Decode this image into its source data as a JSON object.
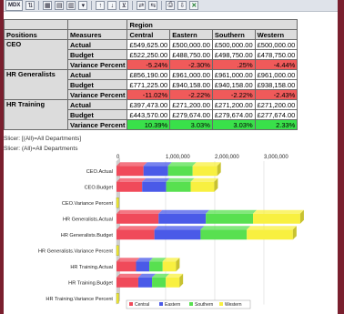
{
  "toolbar": {
    "mdx_label": "MDX",
    "icons": [
      "sort-icon",
      "table-view-icon",
      "chart-view-icon",
      "both-view-icon",
      "chart-type-icon",
      "drill-up-icon",
      "drill-down-icon",
      "filter-icon",
      "swap-axis-icon",
      "print-icon",
      "export-icon",
      "excel-icon"
    ]
  },
  "table": {
    "region_label": "Region",
    "col_positions": "Positions",
    "col_measures": "Measures",
    "regions": [
      "Central",
      "Eastern",
      "Southern",
      "Western"
    ],
    "groups": [
      {
        "position": "CEO",
        "rows": [
          {
            "measure": "Actual",
            "values": [
              "£549,625.00",
              "£500,000.00",
              "£500,000.00",
              "£500,000.00"
            ],
            "style": "num"
          },
          {
            "measure": "Budget",
            "values": [
              "£522,250.00",
              "£488,750.00",
              "£498,750.00",
              "£478,750.00"
            ],
            "style": "num"
          },
          {
            "measure": "Variance Percent",
            "values": [
              "-5.24%",
              "-2.30%",
              ".25%",
              "-4.44%"
            ],
            "style": "red"
          }
        ]
      },
      {
        "position": "HR Generalists",
        "rows": [
          {
            "measure": "Actual",
            "values": [
              "£856,190.00",
              "£961,000.00",
              "£961,000.00",
              "£961,000.00"
            ],
            "style": "num"
          },
          {
            "measure": "Budget",
            "values": [
              "£771,225.00",
              "£940,158.00",
              "£940,158.00",
              "£938,158.00"
            ],
            "style": "num"
          },
          {
            "measure": "Variance Percent",
            "values": [
              "-11.02%",
              "-2.22%",
              "-2.22%",
              "-2.43%"
            ],
            "style": "red"
          }
        ]
      },
      {
        "position": "HR Training",
        "rows": [
          {
            "measure": "Actual",
            "values": [
              "£397,473.00",
              "£271,200.00",
              "£271,200.00",
              "£271,200.00"
            ],
            "style": "num"
          },
          {
            "measure": "Budget",
            "values": [
              "£443,570.00",
              "£279,674.00",
              "£279,674.00",
              "£277,674.00"
            ],
            "style": "num"
          },
          {
            "measure": "Variance Percent",
            "values": [
              "10.39%",
              "3.03%",
              "3.03%",
              "2.33%"
            ],
            "style": "green"
          }
        ]
      }
    ]
  },
  "slicer_1": "Slicer: [(All)=All Departments]",
  "slicer_2": "Slicer: (All)=All Departments",
  "chart_data": {
    "type": "bar",
    "orientation": "horizontal",
    "stacked": true,
    "categories": [
      "CEO.Actual",
      "CEO.Budget",
      "CEO.Variance Percent",
      "HR Generalists.Actual",
      "HR Generalists.Budget",
      "HR Generalists.Variance Percent",
      "HR Training.Actual",
      "HR Training.Budget",
      "HR Training.Variance Percent"
    ],
    "series": [
      {
        "name": "Central",
        "color": "#f04a5a",
        "values": [
          549625,
          522250,
          0,
          856190,
          771225,
          0,
          397473,
          443570,
          0
        ]
      },
      {
        "name": "Eastern",
        "color": "#4a5ae8",
        "values": [
          500000,
          488750,
          0,
          961000,
          940158,
          0,
          271200,
          279674,
          0
        ]
      },
      {
        "name": "Southern",
        "color": "#58e050",
        "values": [
          500000,
          498750,
          0,
          961000,
          940158,
          0,
          271200,
          279674,
          0
        ]
      },
      {
        "name": "Western",
        "color": "#f8f040",
        "values": [
          500000,
          478750,
          0,
          961000,
          938158,
          0,
          271200,
          277674,
          0
        ]
      }
    ],
    "xticks": [
      "0",
      "1,000,000",
      "2,000,000",
      "3,000,000"
    ],
    "xlim": [
      0,
      4000000
    ],
    "legend_position": "bottom"
  }
}
